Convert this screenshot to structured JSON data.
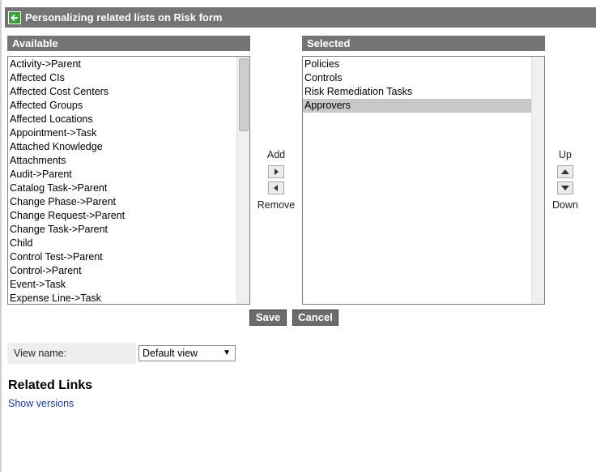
{
  "header": {
    "title": "Personalizing related lists on Risk form"
  },
  "available": {
    "label": "Available",
    "items": [
      "Activity->Parent",
      "Affected CIs",
      "Affected Cost Centers",
      "Affected Groups",
      "Affected Locations",
      "Appointment->Task",
      "Attached Knowledge",
      "Attachments",
      "Audit->Parent",
      "Catalog Task->Parent",
      "Change Phase->Parent",
      "Change Request->Parent",
      "Change Task->Parent",
      "Child",
      "Control Test->Parent",
      "Control->Parent",
      "Event->Task",
      "Expense Line->Task"
    ]
  },
  "selected": {
    "label": "Selected",
    "items": [
      "Policies",
      "Controls",
      "Risk Remediation Tasks",
      "Approvers"
    ],
    "highlighted_index": 3
  },
  "controls": {
    "add": "Add",
    "remove": "Remove",
    "up": "Up",
    "down": "Down"
  },
  "buttons": {
    "save": "Save",
    "cancel": "Cancel"
  },
  "view": {
    "label": "View name:",
    "selected": "Default view"
  },
  "related_links": {
    "title": "Related Links",
    "show_versions": "Show versions"
  },
  "colors": {
    "header_bg": "#747474",
    "selection_bg": "#c8c8c8",
    "link": "#1a3aa8",
    "back_icon": "#3aa13a"
  }
}
